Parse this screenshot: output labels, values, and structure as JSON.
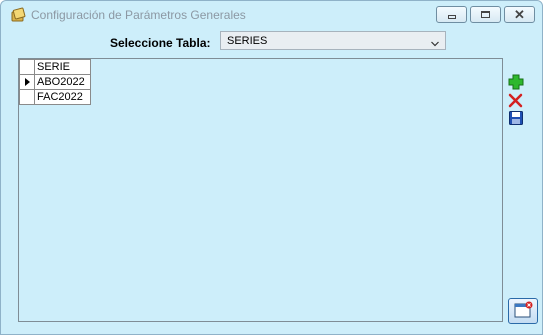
{
  "window": {
    "title": "Configuración de Parámetros Generales",
    "icon": "form-icon",
    "controls": {
      "minimize": "minimize-icon",
      "maximize": "maximize-icon",
      "close": "close-icon"
    }
  },
  "selector": {
    "label": "Seleccione Tabla:",
    "value": "SERIES",
    "arrow_icon": "chevron-down-icon"
  },
  "grid": {
    "columns": [
      "SERIE"
    ],
    "rows": [
      {
        "SERIE": "ABO2022",
        "current": true
      },
      {
        "SERIE": "FAC2022",
        "current": false
      }
    ]
  },
  "actions": {
    "add_icon": "plus-icon",
    "delete_icon": "delete-x-icon",
    "save_icon": "floppy-disk-icon",
    "exit_icon": "exit-window-icon"
  },
  "colors": {
    "background": "#cdeefa",
    "add_green": "#2db82d",
    "delete_red": "#d32020",
    "save_blue": "#1f4fb3"
  }
}
